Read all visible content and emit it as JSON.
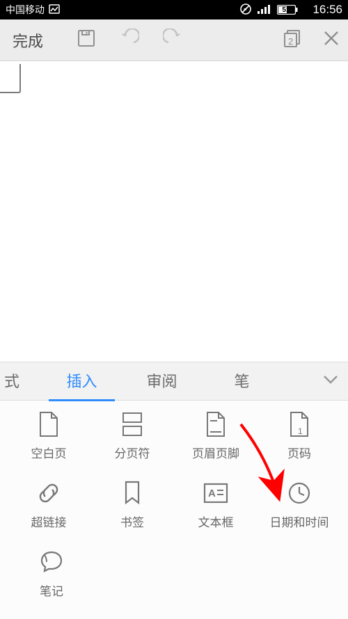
{
  "status": {
    "carrier": "中国移动",
    "battery_pct": "51",
    "time": "16:56"
  },
  "toolbar": {
    "done": "完成",
    "page_count": "2"
  },
  "tabs": {
    "partial": "式",
    "insert": "插入",
    "review": "审阅",
    "pen": "笔"
  },
  "insert_grid": {
    "blank_page": "空白页",
    "page_break": "分页符",
    "header_footer": "页眉页脚",
    "page_number": "页码",
    "hyperlink": "超链接",
    "bookmark": "书签",
    "textbox": "文本框",
    "datetime": "日期和时间",
    "note": "笔记"
  }
}
